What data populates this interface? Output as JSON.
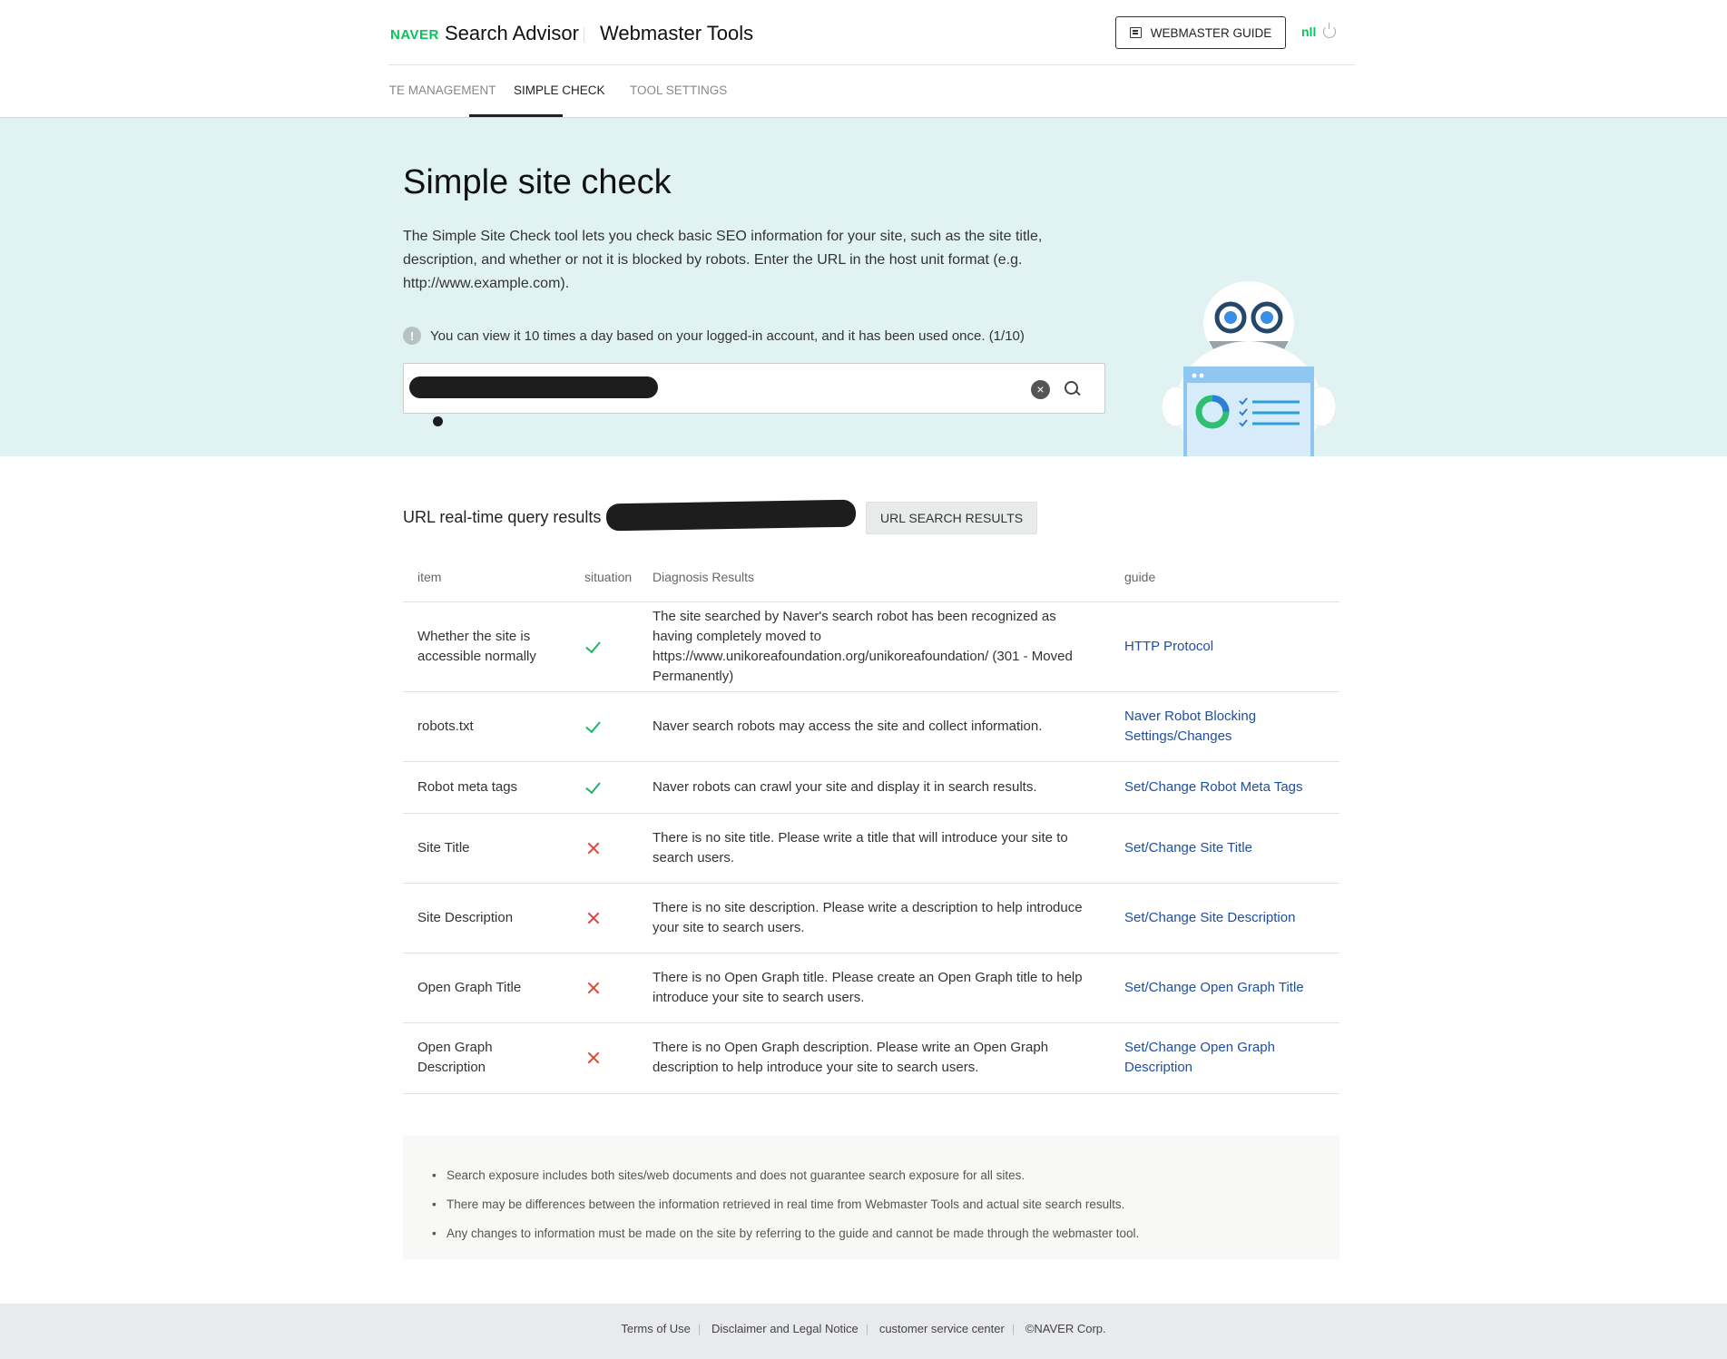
{
  "header": {
    "logo": "NAVER",
    "brand": "Search Advisor",
    "subtitle": "Webmaster Tools",
    "guide_button": "WEBMASTER GUIDE",
    "user": "nll"
  },
  "nav": {
    "tabs": [
      {
        "label": "SITE MANAGEMENT"
      },
      {
        "label": "SIMPLE CHECK",
        "active": true
      },
      {
        "label": "TOOL SETTINGS"
      }
    ]
  },
  "hero": {
    "title": "Simple site check",
    "description": "The Simple Site Check tool lets you check basic SEO information for your site, such as the site title, description, and whether or not it is blocked by robots. Enter the URL in the host unit format (e.g. http://www.example.com).",
    "notice": "You can view it 10 times a day based on your logged-in account, and it has been used once. (1/10)",
    "info_icon": "!"
  },
  "results": {
    "title": "URL real-time query results",
    "url_button": "URL SEARCH RESULTS",
    "columns": [
      "item",
      "situation",
      "Diagnosis Results",
      "guide"
    ],
    "rows": [
      {
        "item": "Whether the site is accessible normally",
        "status": "pass",
        "diagnosis": "The site searched by Naver's search robot has been recognized as having completely moved to https://www.unikoreafoundation.org/unikoreafoundation/ (301 - Moved Permanently)",
        "guide": "HTTP Protocol"
      },
      {
        "item": "robots.txt",
        "status": "pass",
        "diagnosis": "Naver search robots may access the site and collect information.",
        "guide": "Naver Robot Blocking Settings/Changes"
      },
      {
        "item": "Robot meta tags",
        "status": "pass",
        "diagnosis": "Naver robots can crawl your site and display it in search results.",
        "guide": "Set/Change Robot Meta Tags"
      },
      {
        "item": "Site Title",
        "status": "fail",
        "diagnosis": "There is no site title. Please write a title that will introduce your site to search users.",
        "guide": "Set/Change Site Title"
      },
      {
        "item": "Site Description",
        "status": "fail",
        "diagnosis": "There is no site description. Please write a description to help introduce your site to search users.",
        "guide": "Set/Change Site Description"
      },
      {
        "item": "Open Graph Title",
        "status": "fail",
        "diagnosis": "There is no Open Graph title. Please create an Open Graph title to help introduce your site to search users.",
        "guide": "Set/Change Open Graph Title"
      },
      {
        "item": "Open Graph Description",
        "status": "fail",
        "diagnosis": "There is no Open Graph description. Please write an Open Graph description to help introduce your site to search users.",
        "guide": "Set/Change Open Graph Description"
      }
    ]
  },
  "notes": [
    "Search exposure includes both sites/web documents and does not guarantee search exposure for all sites.",
    "There may be differences between the information retrieved in real time from Webmaster Tools and actual site search results.",
    "Any changes to information must be made on the site by referring to the guide and cannot be made through the webmaster tool."
  ],
  "footer": {
    "links": [
      "Terms of Use",
      "Disclaimer and Legal Notice",
      "customer service center"
    ],
    "copyright": "©NAVER Corp."
  },
  "colors": {
    "brand_green": "#03c75a",
    "hero_bg": "#e0f3f2",
    "link_blue": "#1e4fa3",
    "pass_green": "#1bb36a",
    "fail_red": "#e0443b"
  }
}
